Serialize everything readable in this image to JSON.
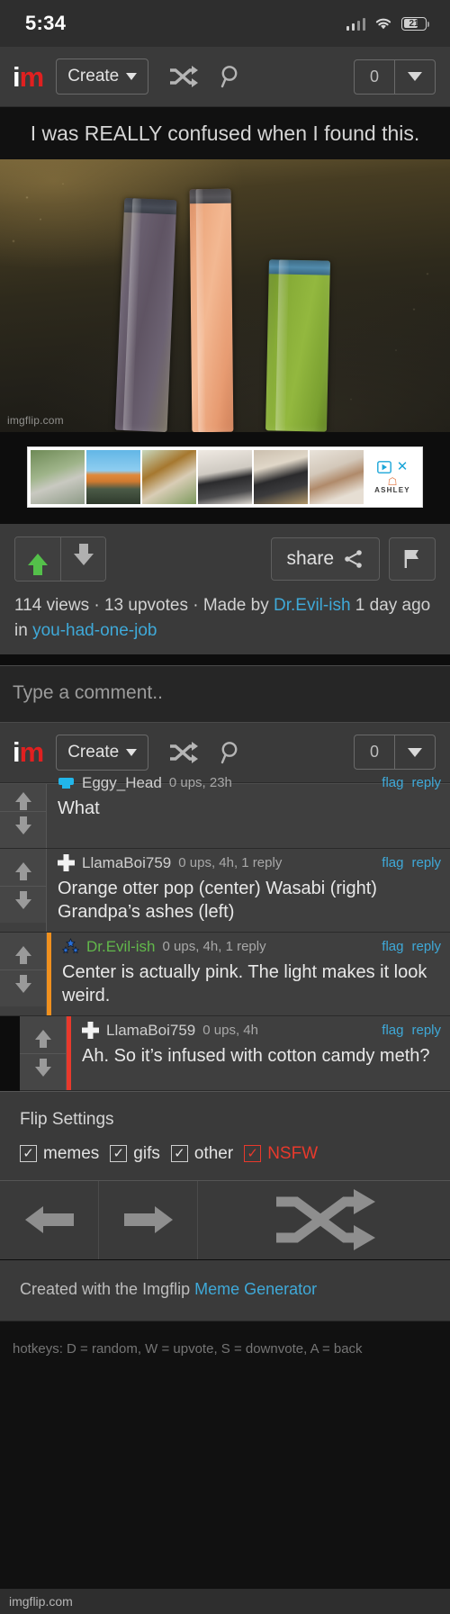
{
  "status_bar": {
    "time": "5:34",
    "battery_text": "21",
    "signal_icon": "cellular-signal-icon",
    "wifi_icon": "wifi-icon",
    "battery_icon": "battery-icon"
  },
  "navbar": {
    "logo_i": "i",
    "logo_m": "m",
    "create_label": "Create",
    "shuffle_icon": "shuffle-icon",
    "search_icon": "search-icon",
    "counter_value": "0",
    "dropdown_icon": "chevron-down-icon"
  },
  "meme": {
    "title": "I was REALLY confused when I found this.",
    "watermark": "imgflip.com",
    "pop_left_label": "grandpas-ashes-freeze-pop",
    "pop_center_label": "orange-otter-pop",
    "pop_right_label": "wasabi-green-freeze-pop"
  },
  "ad": {
    "advertiser": "ASHLEY",
    "close_label": "✕",
    "adchoices_icon": "adchoices-icon",
    "thumbnails": [
      "patio-dining-set",
      "patio-umbrella-set",
      "porch-swing",
      "metal-bunk-bed",
      "console-table",
      "walk-in-closet"
    ]
  },
  "actions": {
    "upvote_icon": "upvote-arrow-icon",
    "downvote_icon": "downvote-arrow-icon",
    "share_label": "share",
    "share_icon": "share-icon",
    "flag_icon": "flag-icon"
  },
  "meta": {
    "views": "114 views",
    "sep1": " · ",
    "upvotes": "13 upvotes",
    "sep2": " · ",
    "made_by": "Made by ",
    "author": "Dr.Evil-ish",
    "time_ago": " 1 day ago in ",
    "stream": "you-had-one-job"
  },
  "comment_box": {
    "placeholder": "Type a comment.."
  },
  "comments": [
    {
      "user": "Eggy_Head",
      "sub": "0 ups, 23h",
      "text": "What",
      "flag": "flag",
      "reply": "reply",
      "avatar": "eggy-head-avatar",
      "is_op": false,
      "accent": "none",
      "indent": 0,
      "clipped": true
    },
    {
      "user": "LlamaBoi759",
      "sub": "0 ups, 4h, 1 reply",
      "text": "Orange otter pop (center) Wasabi (right) Grandpa’s ashes (left)",
      "flag": "flag",
      "reply": "reply",
      "avatar": "llamaboi759-avatar",
      "is_op": false,
      "accent": "none",
      "indent": 0,
      "clipped": false
    },
    {
      "user": "Dr.Evil-ish",
      "sub": "0 ups, 4h, 1 reply",
      "text": "Center is actually pink. The light makes it look weird.",
      "flag": "flag",
      "reply": "reply",
      "avatar": "dr-evil-ish-avatar",
      "is_op": true,
      "accent": "orange",
      "indent": 0,
      "clipped": false
    },
    {
      "user": "LlamaBoi759",
      "sub": "0 ups, 4h",
      "text": "Ah. So it’s infused with cotton camdy meth?",
      "flag": "flag",
      "reply": "reply",
      "avatar": "llamaboi759-avatar",
      "is_op": false,
      "accent": "red",
      "indent": 1,
      "clipped": false
    }
  ],
  "flip_settings": {
    "title": "Flip Settings",
    "check_glyph": "✓",
    "options": [
      {
        "label": "memes",
        "checked": true,
        "highlight": false
      },
      {
        "label": "gifs",
        "checked": true,
        "highlight": false
      },
      {
        "label": "other",
        "checked": true,
        "highlight": false
      },
      {
        "label": "NSFW",
        "checked": true,
        "highlight": true
      }
    ],
    "back_icon": "arrow-left-icon",
    "forward_icon": "arrow-right-icon",
    "random_icon": "shuffle-icon"
  },
  "footer": {
    "created_prefix": "Created with the Imgflip ",
    "created_link": "Meme Generator",
    "hotkeys": "hotkeys: D = random, W = upvote, S = downvote, A = back",
    "domain": "imgflip.com"
  },
  "colors": {
    "brand_red": "#e02020",
    "link_blue": "#3fa9d8",
    "op_green": "#62b84b",
    "upvote_green": "#54c04a",
    "nsfw_red": "#e8392c",
    "accent_orange": "#f0901e"
  }
}
